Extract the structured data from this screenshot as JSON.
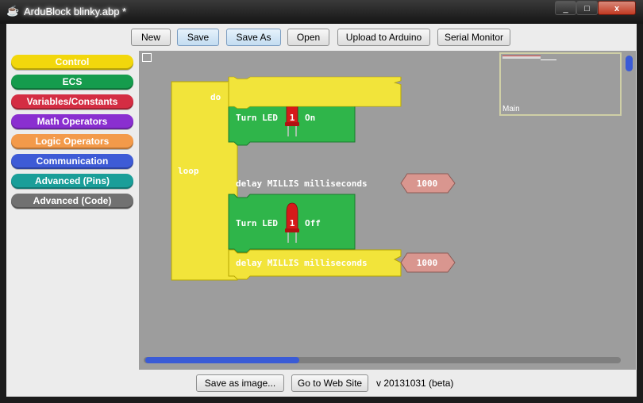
{
  "window": {
    "title": "ArduBlock blinky.abp *",
    "close_glyph": "x",
    "max_glyph": "□",
    "min_glyph": "_"
  },
  "toolbar": {
    "buttons": [
      {
        "label": "New"
      },
      {
        "label": "Save"
      },
      {
        "label": "Save As"
      },
      {
        "label": "Open"
      },
      {
        "label": "Upload to Arduino"
      },
      {
        "label": "Serial Monitor"
      }
    ]
  },
  "categories": [
    {
      "label": "Control",
      "color": "#f2d70c"
    },
    {
      "label": "ECS",
      "color": "#159c4d"
    },
    {
      "label": "Variables/Constants",
      "color": "#d42d43"
    },
    {
      "label": "Math Operators",
      "color": "#8a2fd0"
    },
    {
      "label": "Logic Operators",
      "color": "#f39a4a"
    },
    {
      "label": "Communication",
      "color": "#3e5bd6"
    },
    {
      "label": "Advanced (Pins)",
      "color": "#1a9e99"
    },
    {
      "label": "Advanced (Code)",
      "color": "#717171"
    }
  ],
  "program": {
    "loop_label": "loop",
    "do_label": "do",
    "led_on": {
      "prefix": "Turn LED",
      "pin": "1",
      "state": "On"
    },
    "delay_1": {
      "label": "delay MILLIS  milliseconds",
      "value": "1000"
    },
    "led_off": {
      "prefix": "Turn LED",
      "pin": "1",
      "state": "Off"
    },
    "delay_2": {
      "label": "delay MILLIS  milliseconds",
      "value": "1000"
    }
  },
  "minimap": {
    "label": "Main"
  },
  "footer": {
    "save_image_label": "Save as image...",
    "website_label": "Go to Web Site",
    "version": "v 20131031 (beta)"
  },
  "colors": {
    "control_yellow": "#f2e43a",
    "ecs_green": "#2fb54a",
    "number_pink": "#d9968f",
    "canvas": "#9d9d9d",
    "accent_blue": "#3a5bd6"
  }
}
